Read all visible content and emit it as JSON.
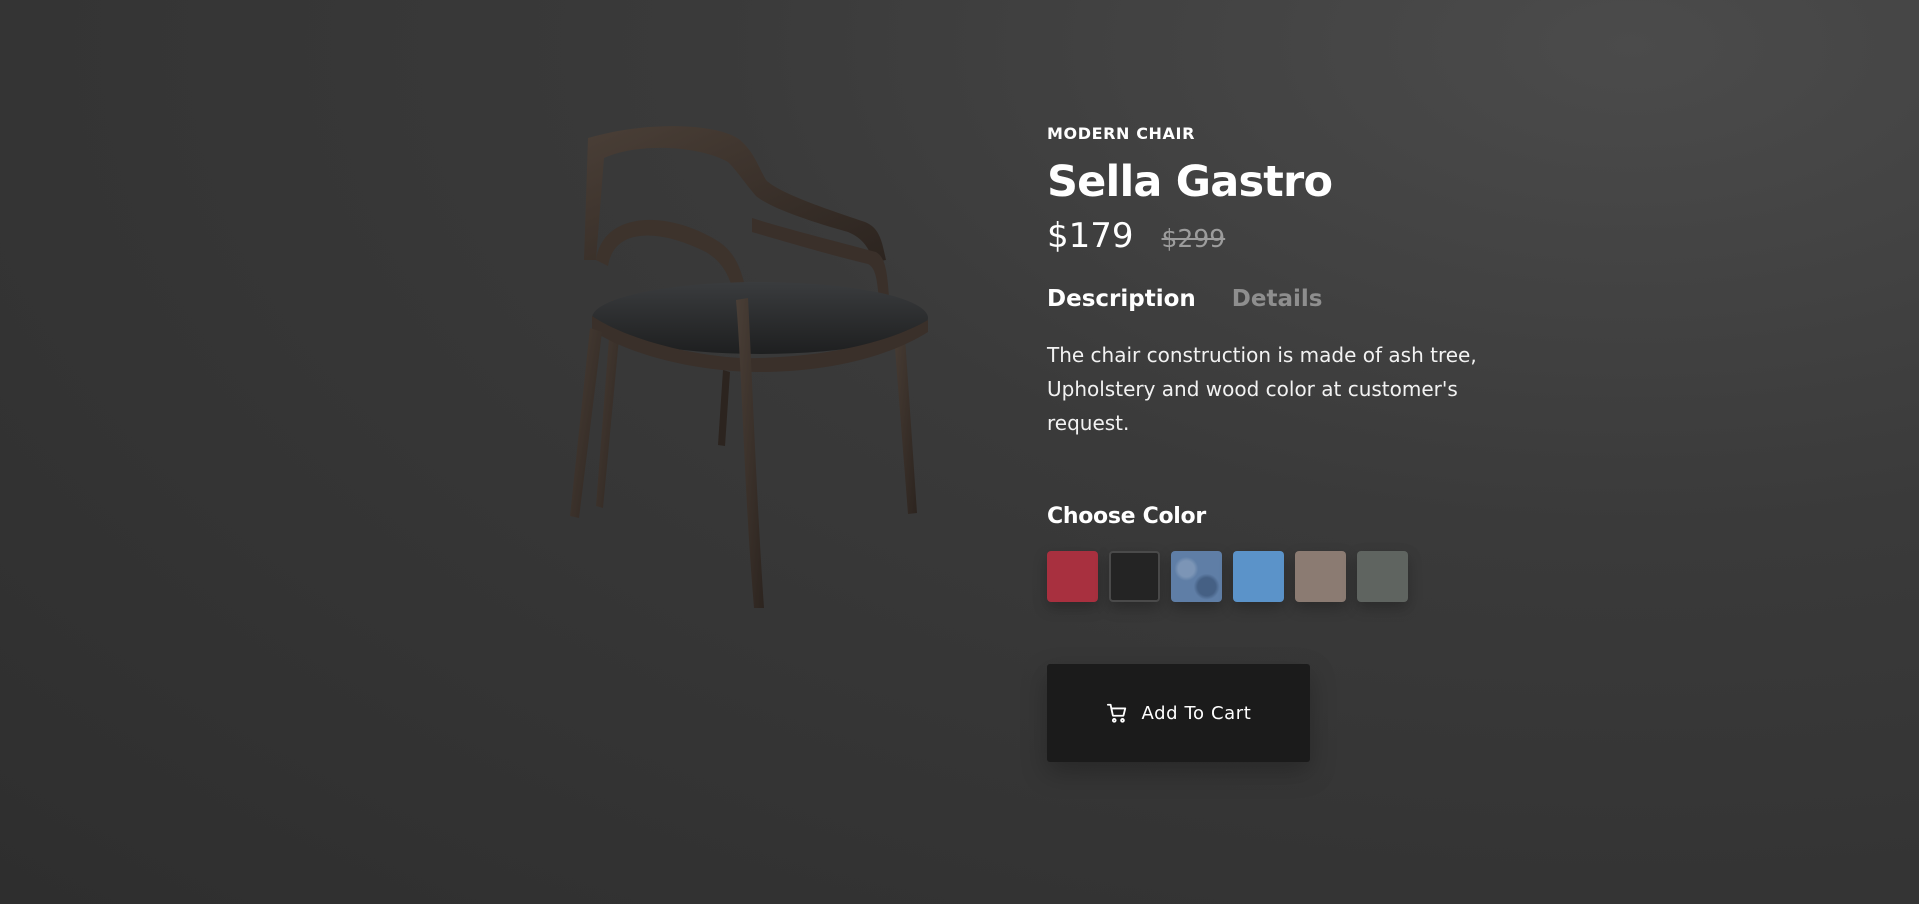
{
  "product": {
    "category": "MODERN CHAIR",
    "name": "Sella Gastro",
    "price": "$179",
    "original_price": "$299",
    "image_subject": "chair-icon"
  },
  "tabs": [
    {
      "label": "Description",
      "active": true
    },
    {
      "label": "Details",
      "active": false
    }
  ],
  "description": "The chair construction is made of ash tree, Upholstery and wood color at customer's request.",
  "color_picker": {
    "heading": "Choose Color",
    "swatches": [
      {
        "name": "red",
        "color": "#a8303f",
        "selected": false
      },
      {
        "name": "black",
        "color": "#242424",
        "selected": true
      },
      {
        "name": "denim",
        "color": "#5f7ea6",
        "selected": false
      },
      {
        "name": "light-blue",
        "color": "#5b93c9",
        "selected": false
      },
      {
        "name": "taupe",
        "color": "#8b7b72",
        "selected": false
      },
      {
        "name": "gray-green",
        "color": "#5f6460",
        "selected": false
      }
    ]
  },
  "cart": {
    "label": "Add To Cart",
    "icon": "cart-icon"
  },
  "colors": {
    "background": "#393939",
    "button_bg": "#1b1b1b",
    "text": "#ffffff",
    "muted_text": "#8e8e8e"
  }
}
